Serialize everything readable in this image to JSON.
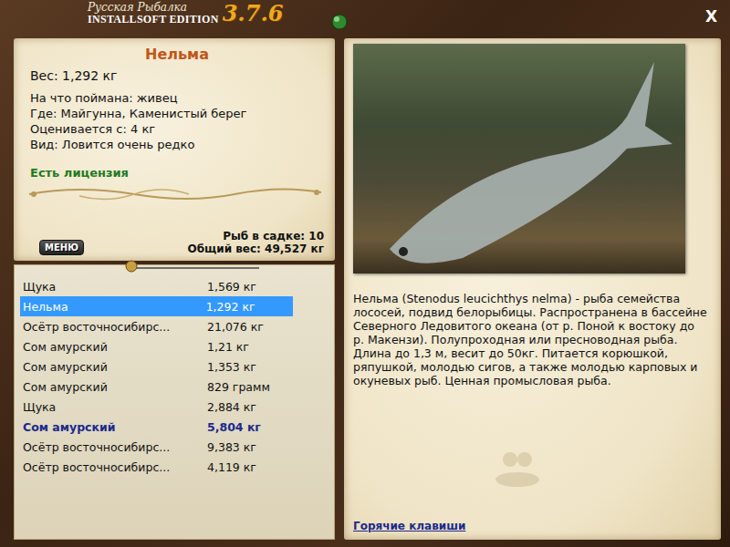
{
  "window": {
    "brand_line1": "Русская Рыбалка",
    "brand_line2": "INSTALLSOFT EDITION",
    "version": "3.7.6",
    "close": "X"
  },
  "fish": {
    "name": "Нельма",
    "weight": "Вес: 1,292 кг",
    "details": [
      "На что поймана: живец",
      "Где: Майгунна, Каменистый берег",
      "Оценивается с: 4 кг",
      "Вид: Ловится очень редко"
    ],
    "license": "Есть лицензия"
  },
  "cage": {
    "count": "Рыб в садке: 10",
    "total": "Общий вес: 49,527 кг"
  },
  "menu_button": "МЕНЮ",
  "catch_list": [
    {
      "name": "Щука",
      "weight": "1,569 кг",
      "selected": false,
      "record": false
    },
    {
      "name": "Нельма",
      "weight": "1,292 кг",
      "selected": true,
      "record": false
    },
    {
      "name": "Осётр восточносибирс...",
      "weight": "21,076 кг",
      "selected": false,
      "record": false
    },
    {
      "name": "Сом амурский",
      "weight": "1,21 кг",
      "selected": false,
      "record": false
    },
    {
      "name": "Сом амурский",
      "weight": "1,353 кг",
      "selected": false,
      "record": false
    },
    {
      "name": "Сом амурский",
      "weight": "829 грамм",
      "selected": false,
      "record": false
    },
    {
      "name": "Щука",
      "weight": "2,884 кг",
      "selected": false,
      "record": false
    },
    {
      "name": "Сом амурский",
      "weight": "5,804 кг",
      "selected": false,
      "record": true
    },
    {
      "name": "Осётр восточносибирс...",
      "weight": "9,383 кг",
      "selected": false,
      "record": false
    },
    {
      "name": "Осётр восточносибирс...",
      "weight": "4,119 кг",
      "selected": false,
      "record": false
    }
  ],
  "description": "Нельма (Stenodus leucichthys nelma) - рыба семейства лососей, подвид белорыбицы. Распространена в бассейне Северного Ледовитого океана (от р. Поной к востоку до р. Макензи). Полупроходная или пресноводная рыба. Длина до 1,3 м, весит до 50кг. Питается корюшкой, ряпушкой, молодью сигов, а также молодью карповых и окуневых рыб. Ценная промысловая рыба.",
  "hotkeys_link": "Горячие клавиши"
}
